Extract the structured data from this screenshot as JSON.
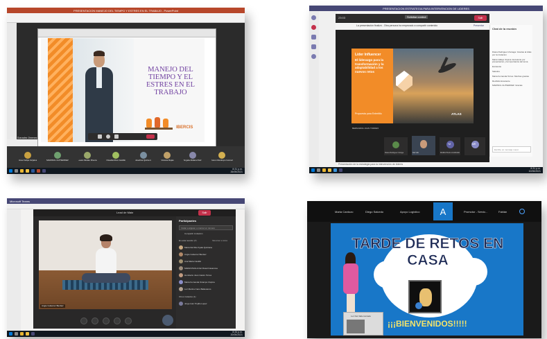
{
  "colors": {
    "teams_purple": "#464775",
    "ppt_orange": "#f28c28",
    "leave_red": "#c4314b",
    "zoom_blue": "#1877c8",
    "win_blue": "#0078d7"
  },
  "panel1": {
    "title": "PRESENTACION MANEJO DEL TIEMPO Y ESTRES EN EL TRABAJO - PowerPoint",
    "slide_title": "MANEJO DEL TIEMPO Y EL ESTRES EN EL TRABAJO",
    "logo": "IBERCIS",
    "speaker": "Mario Gonzalez Jimenez",
    "participants": [
      "Jose Felipe Grijalva",
      "MARISOL GUTIERREZ",
      "Laura Mulato Rivera",
      "Claudia Rios Castillo",
      "Josefina Quintero",
      "Viviana Rojas",
      "Angela Aldana Ruiz",
      "Karen Restrepo Gomez"
    ],
    "clock": "8:31 p.m.\n26/05/2021"
  },
  "panel2": {
    "title": "PRESENTACION ESTRATEGIA PARA INTERVENCION DE LIDERES",
    "meeting_time": "23:03",
    "share_button": "Solicitar control",
    "presenting_notice": "La presentación finalizó - Otra persona ha empezado a compartir contenido",
    "stop_label": "Presentar",
    "leave": "Salir",
    "chat_header": "Chat de la reunión",
    "slide_heading": "Líder Influencer",
    "slide_body": "El liderazgo para la transformación y la adaptabilidad a los nuevos retos",
    "slide_footer": "Propuesta para Entertitlo",
    "logo": "ATLAS",
    "presenter_label": "BERNARDA JUAN TORRES",
    "chat_messages": [
      "Diana Rodriguez Zuniaga: Gracias al Atlas por la invitacion",
      "Maria Vallejo Ospina: Excelente por presentacion y la importancia del tema",
      "Excelente",
      "Saludos",
      "Maria Fernanda Torres: Muchas gracias",
      "Recibido Excelente",
      "MARISOL GUTIERREZ: Gracias"
    ],
    "chat_input": "Escribe un mensaje nuevo",
    "caption": "Presentación de la estrategia para la intervención de líderes",
    "tiles": [
      "Diana Rodriguez Zuniga",
      "Dal Gilio",
      "YA",
      "MARIA PAULA GUEVARA",
      "MR"
    ],
    "clock": "8:31 p.m.\n10/06/2021"
  },
  "panel3": {
    "title": "Lead de Mata",
    "app_title": "Microsoft Teams",
    "leave": "Salir",
    "participants_header": "Participantes",
    "invite_placeholder": "Invitar a alguien o marcar un número",
    "share_invite": "Compartir invitación",
    "in_meeting": "En esta reunión (7)",
    "mute_all": "Silenciar a todos",
    "participants": [
      "Maria Del Mar Ayala Quintana",
      "Angie Gutierrez Benitez",
      "Ana Maria Castillo",
      "MARIA PAULA Del Rosal Casanova",
      "Humberto Juan Castro Torres",
      "Maria Fernanda Ocampo Ospina",
      "Luz Marina Cano Ballesteros"
    ],
    "others_header": "Otros invitados (1)",
    "other": "Jorge Ivan Trujillo Lopez",
    "video_label": "Angie Gutierrez Benitez",
    "clock": "8:34 p.m.\n20/05/2021"
  },
  "panel4": {
    "participants": [
      "Marta Cardozo",
      "Diego Salcedo",
      "Apoyo Logístico",
      "Promotor - Servic...",
      "Fabián"
    ],
    "active_initial": "A",
    "heading": "TARDE DE RETOS EN CASA",
    "welcome": "¡¡¡BIENVENIDOS!!!!!",
    "video_label": "Luz Del Valle Hurtado"
  }
}
